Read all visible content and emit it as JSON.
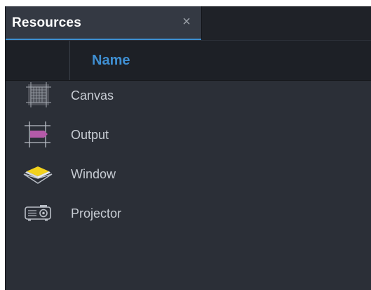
{
  "panel": {
    "tab_title": "Resources",
    "close_glyph": "×",
    "column_header": "Name"
  },
  "resources": [
    {
      "label": "Canvas",
      "icon": "canvas-grid-icon"
    },
    {
      "label": "Output",
      "icon": "output-icon",
      "icon_color": "#b45aa8"
    },
    {
      "label": "Window",
      "icon": "window-icon",
      "icon_color": "#f2d21d"
    },
    {
      "label": "Projector",
      "icon": "projector-icon"
    }
  ],
  "colors": {
    "accent": "#3d8fd1",
    "panel_bg": "#2b2f37",
    "header_bg": "#1d2026",
    "text": "#c7ccd3"
  }
}
